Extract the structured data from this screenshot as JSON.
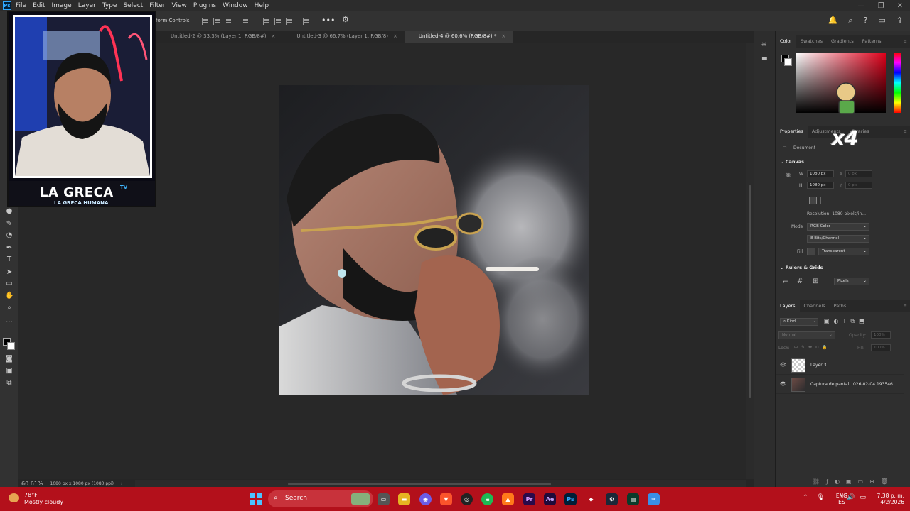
{
  "menubar": {
    "logo": "Ps",
    "items": [
      "File",
      "Edit",
      "Image",
      "Layer",
      "Type",
      "Select",
      "Filter",
      "View",
      "Plugins",
      "Window",
      "Help"
    ],
    "window_controls": [
      "—",
      "❐",
      "✕"
    ]
  },
  "options_bar": {
    "transform_label": "form Controls",
    "more_label": "•••"
  },
  "tabs": [
    {
      "label": "Untitled-2 @ 33.3% (Layer 1, RGB/8#)",
      "close": "×",
      "active": false
    },
    {
      "label": "Untitled-3 @ 66.7% (Layer 1, RGB/8)",
      "close": "×",
      "active": false
    },
    {
      "label": "Untitled-4 @ 60.6% (RGB/8#) *",
      "close": "×",
      "active": true
    }
  ],
  "status": {
    "zoom": "60.61%",
    "doc_info": "1080 px x 1080 px (1080 ppi)",
    "arrow": "›"
  },
  "webcam": {
    "title": "LA GRECA",
    "title_sup": "TV",
    "subtitle": "LA GRECA HUMANA"
  },
  "sticker": {
    "text": "x4"
  },
  "color_panel": {
    "tabs": [
      "Color",
      "Swatches",
      "Gradients",
      "Patterns"
    ],
    "active_tab": "Color"
  },
  "properties_panel": {
    "tabs": [
      "Properties",
      "Adjustments",
      "Libraries"
    ],
    "doc_label": "Document",
    "canvas_section": "Canvas",
    "w_label": "W",
    "w_value": "1080 px",
    "h_label": "H",
    "h_value": "1080 px",
    "x_label": "X",
    "y_label": "Y",
    "x_value": "0 px",
    "y_value": "0 px",
    "resolution": "Resolution: 1080 pixels/in...",
    "mode_label": "Mode",
    "mode_value": "RGB Color",
    "bits_value": "8 Bits/Channel",
    "fill_label": "Fill",
    "fill_value": "Transparent",
    "rulers_section": "Rulers & Grids",
    "units_value": "Pixels"
  },
  "layers_panel": {
    "tabs": [
      "Layers",
      "Channels",
      "Paths"
    ],
    "kind_label": "Kind",
    "blend_mode": "Normal",
    "opacity_label": "Opacity:",
    "opacity_value": "100%",
    "lock_label": "Lock:",
    "fill_label": "Fill:",
    "fill_value": "100%",
    "layers": [
      {
        "name": "Layer 3"
      },
      {
        "name": "Captura de pantal...026-02-04 193546"
      }
    ]
  },
  "taskbar": {
    "weather_temp": "78°F",
    "weather_desc": "Mostly cloudy",
    "search_label": "Search",
    "lang_top": "ENG",
    "lang_bottom": "ES",
    "time": "7:38 p. m.",
    "date": "4/2/2026",
    "apps": [
      "Pr",
      "Ae",
      "Ps"
    ]
  },
  "colors": {
    "accent": "#31a8ff",
    "taskbar": "#b3101b"
  }
}
